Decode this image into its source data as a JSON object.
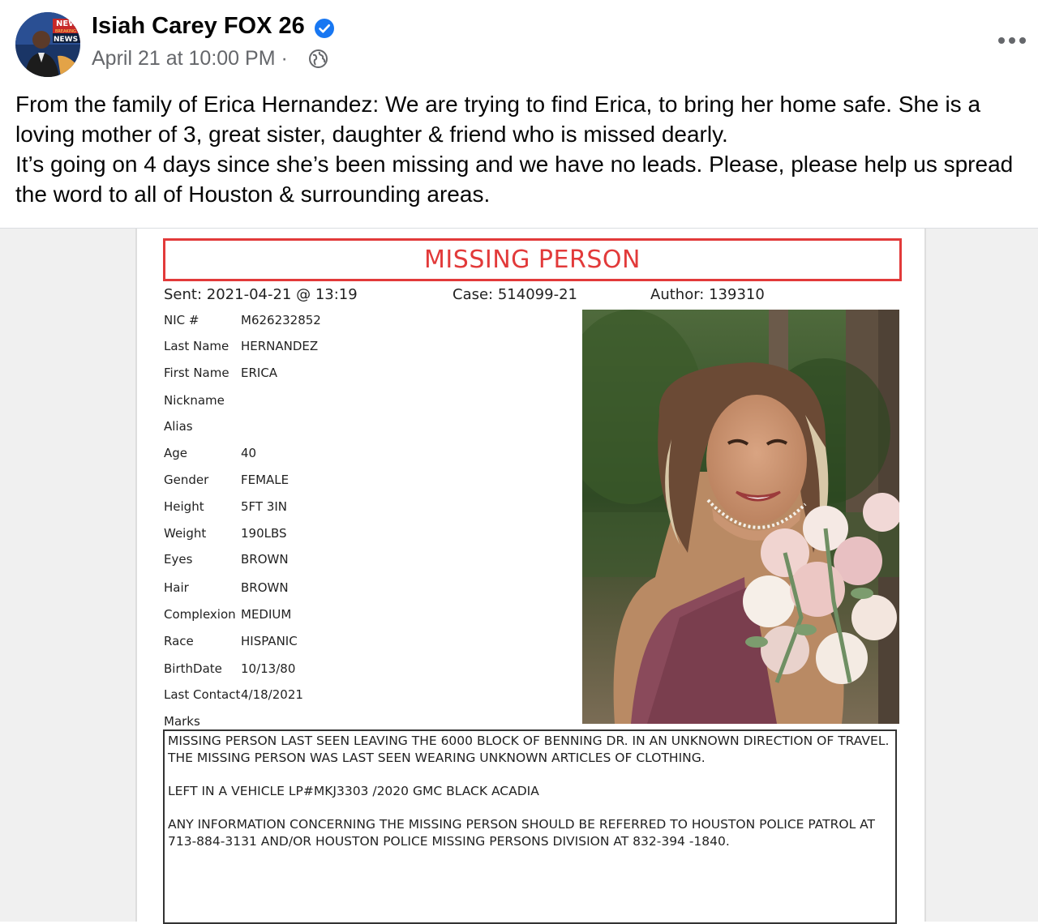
{
  "post": {
    "author": "Isiah Carey FOX 26",
    "date": "April 21 at 10:00 PM",
    "separator": "·",
    "verified_icon": "verified-badge-icon",
    "privacy_icon": "globe-icon",
    "more_icon": "more-options-icon",
    "avatar_overlay_top": "NEWS",
    "avatar_overlay_mid": "BREAKING",
    "avatar_overlay_bot": "NEWS",
    "text_lines": [
      "From the family of Erica Hernandez: We are trying to find Erica, to bring her home safe. She is a loving mother of 3, great sister, daughter & friend who is missed dearly.",
      "It’s going on 4 days since she’s been missing and we have no leads. Please, please help us spread the word to all of Houston & surrounding areas."
    ]
  },
  "document": {
    "title": "MISSING PERSON",
    "sent_label": "Sent:",
    "sent_value": "2021-04-21 @ 13:19",
    "case_label": "Case:",
    "case_value": "514099-21",
    "author_label": "Author:",
    "author_value": "139310",
    "fields": [
      {
        "label": "NIC #",
        "value": "M626232852"
      },
      {
        "label": "Last Name",
        "value": "HERNANDEZ"
      },
      {
        "label": "First Name",
        "value": "ERICA"
      },
      {
        "label": "Nickname",
        "value": ""
      },
      {
        "label": "Alias",
        "value": ""
      },
      {
        "label": "Age",
        "value": "40"
      },
      {
        "label": "Gender",
        "value": "FEMALE"
      },
      {
        "label": "Height",
        "value": "5FT 3IN"
      },
      {
        "label": "Weight",
        "value": "190LBS"
      },
      {
        "label": "Eyes",
        "value": "BROWN"
      },
      {
        "label": "Hair",
        "value": "BROWN"
      },
      {
        "label": "Complexion",
        "value": "MEDIUM"
      },
      {
        "label": "Race",
        "value": "HISPANIC"
      },
      {
        "label": "BirthDate",
        "value": "10/13/80"
      },
      {
        "label": "Last Contact",
        "value": "4/18/2021"
      },
      {
        "label": "Marks",
        "value": ""
      }
    ],
    "marks_paragraphs": [
      "MISSING PERSON LAST SEEN LEAVING THE 6000 BLOCK OF BENNING DR. IN AN UNKNOWN DIRECTION OF TRAVEL. THE MISSING PERSON WAS LAST SEEN WEARING UNKNOWN ARTICLES OF CLOTHING.",
      "LEFT IN A VEHICLE LP#MKJ3303 /2020 GMC BLACK ACADIA",
      "ANY INFORMATION CONCERNING THE MISSING PERSON SHOULD BE REFERRED TO HOUSTON POLICE PATROL AT 713-884-3131 AND/OR HOUSTON POLICE MISSING PERSONS DIVISION AT 832-394 -1840."
    ]
  },
  "colors": {
    "title_red": "#e23a3a",
    "verified_blue": "#1877f2",
    "meta_gray": "#65676b"
  }
}
